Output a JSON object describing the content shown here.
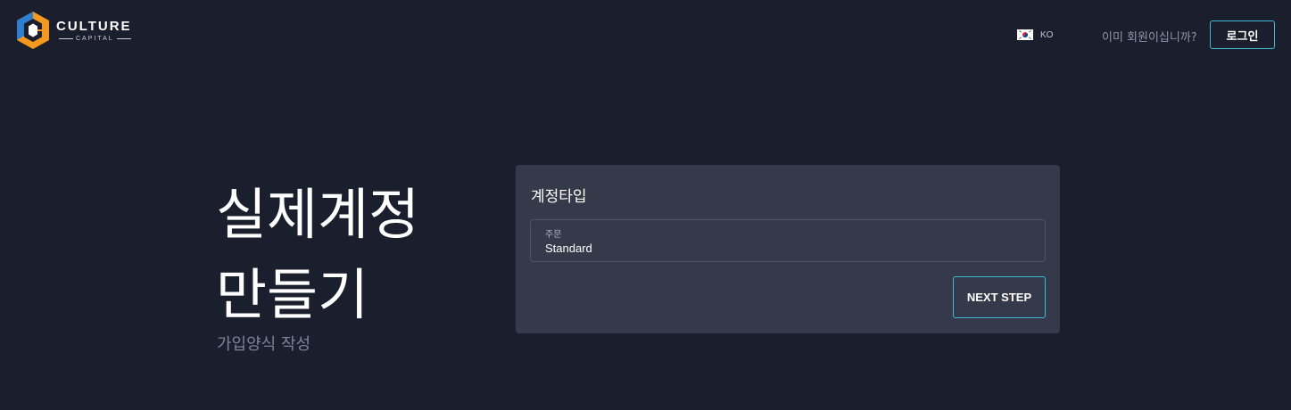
{
  "header": {
    "logo": {
      "word": "CULTURE",
      "sub": "CAPITAL"
    },
    "language": {
      "code": "KO",
      "flag_icon": "south-korea-flag-icon"
    },
    "member_question": "이미 회원이십니까?",
    "login_label": "로그인"
  },
  "hero": {
    "title_line1": "실제계정",
    "title_line2": "만들기",
    "subtitle": "가입양식 작성"
  },
  "form": {
    "title": "계정타입",
    "account_type": {
      "label": "주문",
      "value": "Standard"
    },
    "next_label": "NEXT STEP"
  },
  "colors": {
    "background": "#1b1f2d",
    "card": "#343a4a",
    "accent": "#3fb8d6",
    "logo_orange": "#f39a1e",
    "logo_blue": "#2f7fd1"
  }
}
